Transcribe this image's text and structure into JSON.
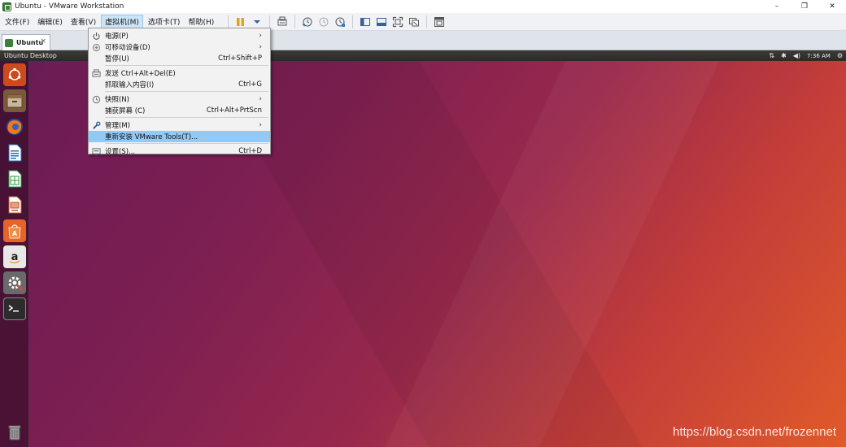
{
  "window": {
    "title": "Ubuntu - VMware Workstation",
    "minimize": "–",
    "maximize": "❐",
    "close": "✕"
  },
  "menubar": {
    "items": [
      "文件(F)",
      "编辑(E)",
      "查看(V)",
      "虚拟机(M)",
      "选项卡(T)",
      "帮助(H)"
    ],
    "active_index": 3
  },
  "tab": {
    "label": "Ubuntu",
    "close": "×"
  },
  "ubuntu": {
    "desktop_title": "Ubuntu Desktop",
    "clock": "7:36 AM",
    "indicator_network": "⇅",
    "indicator_bluetooth": "✱",
    "indicator_volume": "◀)",
    "indicator_settings": "⚙"
  },
  "dropdown": {
    "items": [
      {
        "label": "电源(P)",
        "shortcut": "",
        "submenu": true,
        "icon": "power-icon"
      },
      {
        "label": "可移动设备(D)",
        "shortcut": "",
        "submenu": true,
        "icon": "removable-device-icon"
      },
      {
        "label": "暂停(U)",
        "shortcut": "Ctrl+Shift+P",
        "submenu": false,
        "icon": ""
      },
      {
        "label": "发送 Ctrl+Alt+Del(E)",
        "shortcut": "",
        "submenu": false,
        "icon": "keyboard-icon"
      },
      {
        "label": "抓取输入内容(I)",
        "shortcut": "Ctrl+G",
        "submenu": false,
        "icon": ""
      },
      {
        "label": "快照(N)",
        "shortcut": "",
        "submenu": true,
        "icon": "snapshot-icon"
      },
      {
        "label": "捕获屏幕 (C)",
        "shortcut": "Ctrl+Alt+PrtScn",
        "submenu": false,
        "icon": ""
      },
      {
        "label": "管理(M)",
        "shortcut": "",
        "submenu": true,
        "icon": "wrench-icon"
      },
      {
        "label": "重新安装 VMware Tools(T)...",
        "shortcut": "",
        "submenu": false,
        "icon": "",
        "highlighted": true
      },
      {
        "label": "设置(S)...",
        "shortcut": "Ctrl+D",
        "submenu": false,
        "icon": "settings-icon"
      }
    ],
    "submenu_arrow": "›"
  },
  "watermark": "https://blog.csdn.net/frozennet",
  "colors": {
    "menu_highlight": "#91c9f7",
    "active_menu": "#cce4f7",
    "ubuntu_orange": "#e95420"
  }
}
